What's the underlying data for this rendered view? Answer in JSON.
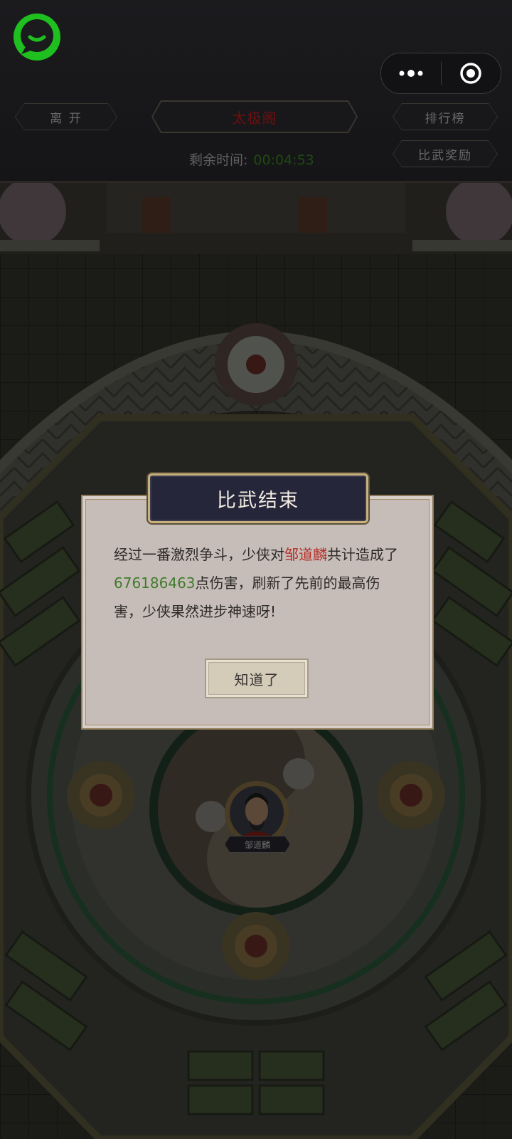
{
  "hud": {
    "leave_label": "离 开",
    "arena_title": "太极阁",
    "rank_label": "排行榜",
    "reward_label": "比武奖励",
    "time_label": "剩余时间:",
    "time_value": "00:04:53"
  },
  "dialog": {
    "title": "比武结束",
    "text_part1": "经过一番激烈争斗，少侠对",
    "opponent_name": "邹道麟",
    "text_part2": "共计造成了",
    "damage_value": "676186463",
    "text_part3": "点伤害，刷新了先前的最高伤害，少侠果然进步神速呀!",
    "confirm_label": "知道了"
  },
  "character": {
    "name": "邹道麟"
  },
  "colors": {
    "accent_green": "#1fbf1f",
    "name_red": "#b62f2a",
    "damage_green": "#3f7b2c"
  },
  "icons": {
    "logo": "chat-bubble-icon",
    "more": "more-dots-icon",
    "close": "target-close-icon"
  }
}
